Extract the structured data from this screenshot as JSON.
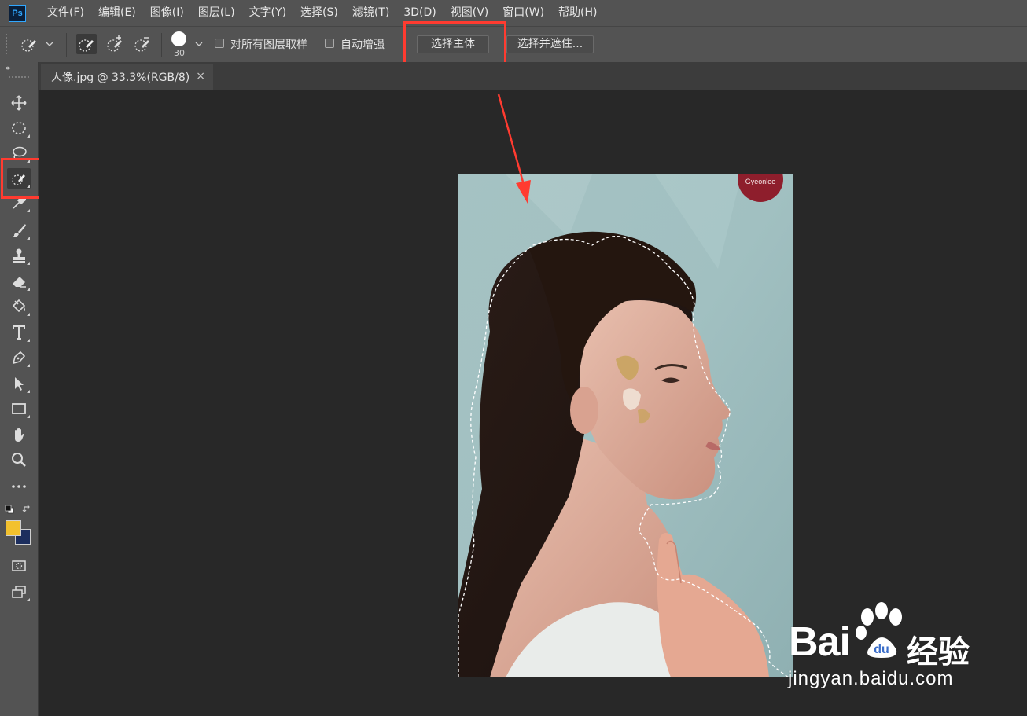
{
  "app": {
    "logo_text": "Ps",
    "menu": [
      "文件(F)",
      "编辑(E)",
      "图像(I)",
      "图层(L)",
      "文字(Y)",
      "选择(S)",
      "滤镜(T)",
      "3D(D)",
      "视图(V)",
      "窗口(W)",
      "帮助(H)"
    ]
  },
  "options_bar": {
    "brush_size": "30",
    "sample_all_layers_label": "对所有图层取样",
    "auto_enhance_label": "自动增强",
    "select_subject_label": "选择主体",
    "select_and_mask_label": "选择并遮住..."
  },
  "document": {
    "tab_title": "人像.jpg @ 33.3%(RGB/8)",
    "close_symbol": "×",
    "photo_badge": "Gyeonlee"
  },
  "colors": {
    "foreground": "#f2c12e",
    "background": "#1c2e5e",
    "highlight": "#ff3b30"
  },
  "watermark": {
    "brand": "Bai",
    "brand_suffix": "经验",
    "url": "jingyan.baidu.com"
  },
  "tools": [
    "move-icon",
    "elliptical-marquee-icon",
    "lasso-icon",
    "quick-selection-icon",
    "eyedropper-icon",
    "brush-icon",
    "stamp-icon",
    "eraser-icon",
    "paint-bucket-icon",
    "type-icon",
    "pen-icon",
    "path-selection-icon",
    "rectangle-icon",
    "hand-icon",
    "zoom-icon",
    "more-icon"
  ]
}
